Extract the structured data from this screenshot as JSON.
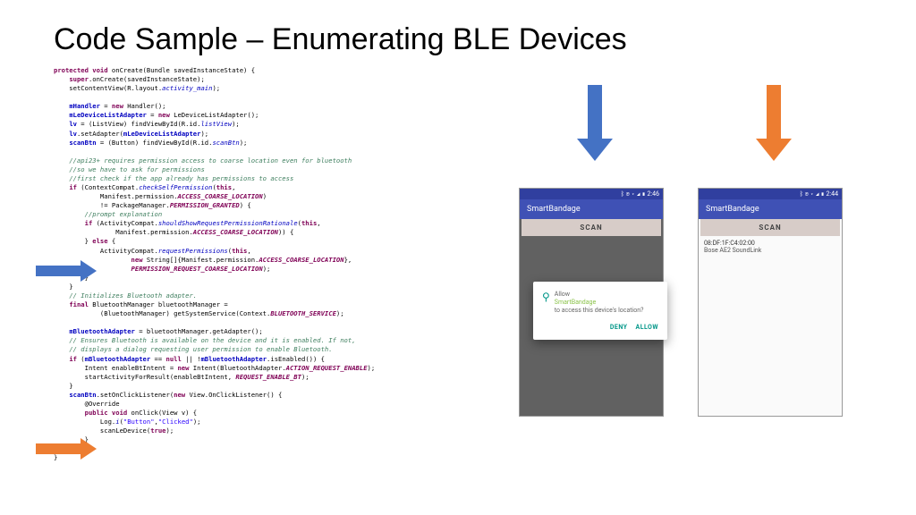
{
  "title": "Code Sample – Enumerating BLE Devices",
  "code_html": "<span class='kw'>protected void</span> onCreate(Bundle savedInstanceState) {\n    <span class='kw'>super</span>.onCreate(savedInstanceState);\n    setContentView(R.layout.<span class='it'>activity_main</span>);\n\n    <span class='fi'>mHandler</span> = <span class='kw'>new</span> Handler();\n    <span class='fi'>mLeDeviceListAdapter</span> = <span class='kw'>new</span> LeDeviceListAdapter();\n    <span class='fi'>lv</span> = (ListView) findViewById(R.id.<span class='it'>listView</span>);\n    <span class='fi'>lv</span>.setAdapter(<span class='fi'>mLeDeviceListAdapter</span>);\n    <span class='fi'>scanBtn</span> = (Button) findViewById(R.id.<span class='it'>scanBtn</span>);\n\n    <span class='cm'>//api23+ requires permission access to coarse location even for bluetooth</span>\n    <span class='cm'>//so we have to ask for permissions</span>\n    <span class='cm'>//first check if the app already has permissions to access</span>\n    <span class='kw'>if</span> (ContextCompat.<span class='it'>checkSelfPermission</span>(<span class='kw'>this</span>,\n            Manifest.permission.<span class='it2'>ACCESS_COARSE_LOCATION</span>)\n            != PackageManager.<span class='it2'>PERMISSION_GRANTED</span>) {\n        <span class='cm'>//prompt explanation</span>\n        <span class='kw'>if</span> (ActivityCompat.<span class='it'>shouldShowRequestPermissionRationale</span>(<span class='kw'>this</span>,\n                Manifest.permission.<span class='it2'>ACCESS_COARSE_LOCATION</span>)) {\n        } <span class='kw'>else</span> {\n            ActivityCompat.<span class='it'>requestPermissions</span>(<span class='kw'>this</span>,\n                    <span class='kw'>new</span> String[]{Manifest.permission.<span class='it2'>ACCESS_COARSE_LOCATION</span>},\n                    <span class='it2'>PERMISSION_REQUEST_COARSE_LOCATION</span>);\n        }\n    }\n    <span class='cm'>// Initializes Bluetooth adapter.</span>\n    <span class='kw'>final</span> BluetoothManager bluetoothManager =\n            (BluetoothManager) getSystemService(Context.<span class='it2'>BLUETOOTH_SERVICE</span>);\n\n    <span class='fi'>mBluetoothAdapter</span> = bluetoothManager.getAdapter();\n    <span class='cm'>// Ensures Bluetooth is available on the device and it is enabled. If not,</span>\n    <span class='cm'>// displays a dialog requesting user permission to enable Bluetooth.</span>\n    <span class='kw'>if</span> (<span class='fi'>mBluetoothAdapter</span> == <span class='kw'>null</span> || !<span class='fi'>mBluetoothAdapter</span>.isEnabled()) {\n        Intent enableBtIntent = <span class='kw'>new</span> Intent(BluetoothAdapter.<span class='it2'>ACTION_REQUEST_ENABLE</span>);\n        startActivityForResult(enableBtIntent, <span class='it2'>REQUEST_ENABLE_BT</span>);\n    }\n    <span class='fi'>scanBtn</span>.setOnClickListener(<span class='kw'>new</span> View.OnClickListener() {\n        @Override\n        <span class='kw'>public void</span> onClick(View v) {\n            Log.<span class='it'>i</span>(<span class='st'>\"Button\"</span>,<span class='st'>\"Clicked\"</span>);\n            scanLeDevice(<span class='kw'>true</span>);\n        }\n    });\n}",
  "phone1": {
    "time": "2:46",
    "icons": "ᛒ ◉ ▾ ◢ ▮",
    "app_title": "SmartBandage",
    "scan_label": "SCAN",
    "dialog": {
      "prefix": "Allow",
      "app": "SmartBandage",
      "suffix": "to access this device's location?",
      "deny": "DENY",
      "allow": "ALLOW"
    }
  },
  "phone2": {
    "time": "2:44",
    "icons": "ᛒ ◉ ▾ ◢ ▮",
    "app_title": "SmartBandage",
    "scan_label": "SCAN",
    "device_mac": "08:DF:1F:C4:02:00",
    "device_name": "Bose AE2 SoundLink"
  }
}
